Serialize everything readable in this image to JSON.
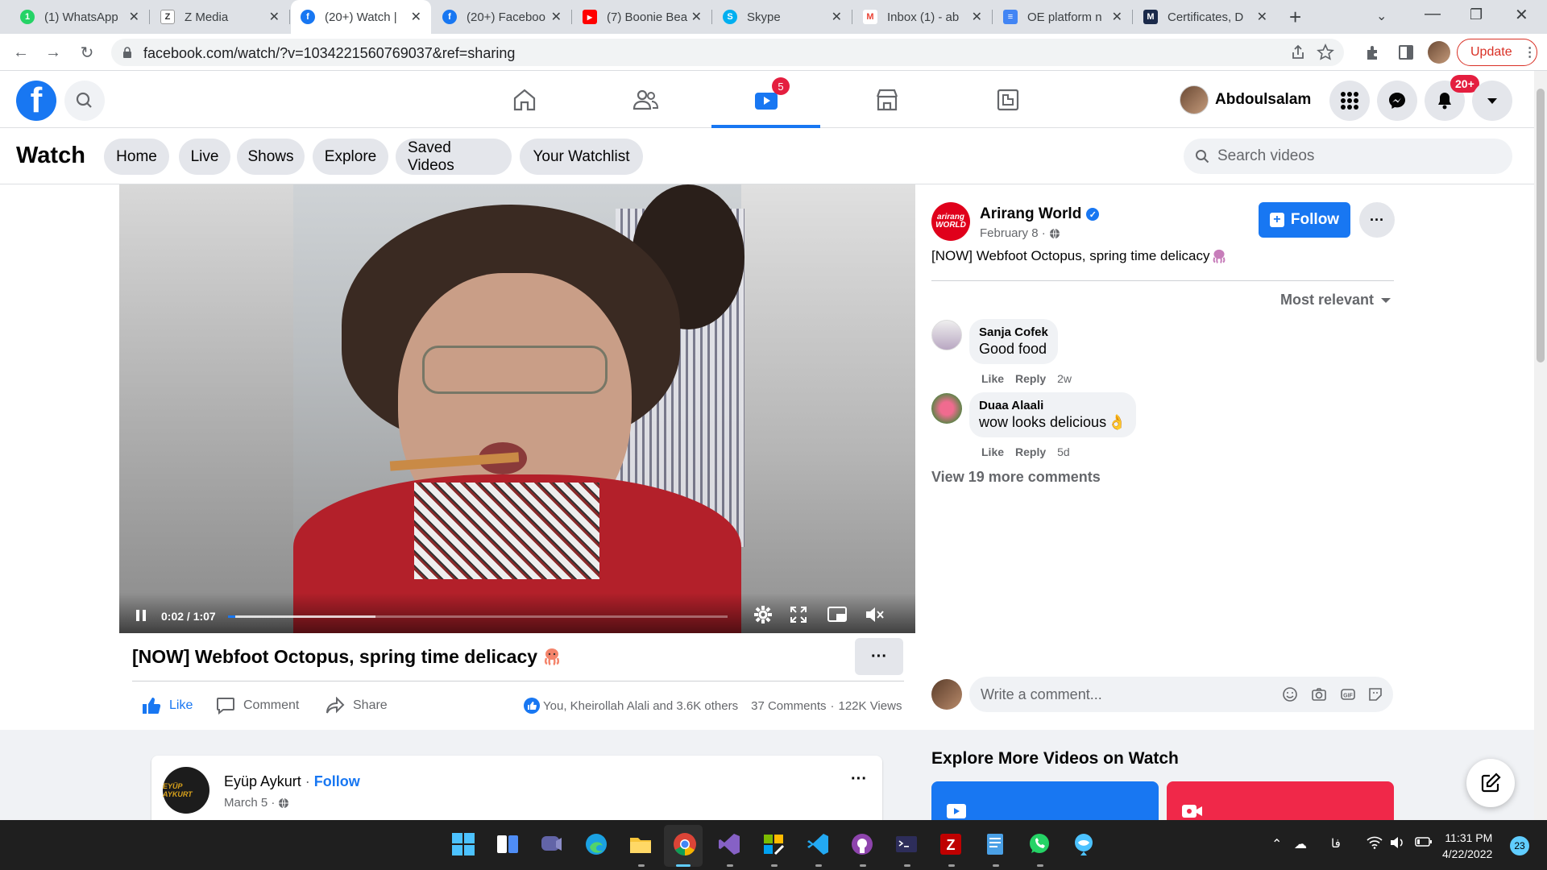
{
  "browser": {
    "tabs": [
      {
        "title": "(1) WhatsApp",
        "favicon": "whatsapp-icon",
        "color": "#25d366",
        "glyph": "1",
        "active": false
      },
      {
        "title": "Z Media",
        "favicon": "z-media-icon",
        "color": "#ffffff",
        "glyph": "Z",
        "active": false
      },
      {
        "title": "(20+) Watch |",
        "favicon": "facebook-icon",
        "color": "#1877f2",
        "glyph": "f",
        "active": true
      },
      {
        "title": "(20+) Faceboo",
        "favicon": "facebook-icon",
        "color": "#1877f2",
        "glyph": "f",
        "active": false
      },
      {
        "title": "(7) Boonie Bea",
        "favicon": "youtube-icon",
        "color": "#ff0000",
        "glyph": "▶",
        "active": false
      },
      {
        "title": "Skype",
        "favicon": "skype-icon",
        "color": "#00aff0",
        "glyph": "S",
        "active": false
      },
      {
        "title": "Inbox (1) - ab",
        "favicon": "gmail-icon",
        "color": "#ffffff",
        "glyph": "M",
        "active": false
      },
      {
        "title": "OE platform n",
        "favicon": "docs-icon",
        "color": "#4285f4",
        "glyph": "≡",
        "active": false
      },
      {
        "title": "Certificates, D",
        "favicon": "m-icon",
        "color": "#1b2a4a",
        "glyph": "M",
        "active": false
      }
    ],
    "url": "facebook.com/watch/?v=1034221560769037&ref=sharing",
    "update_label": "Update"
  },
  "fb": {
    "notification_badge_nav": "5",
    "user_name": "Abdoulsalam",
    "notification_badge": "20+",
    "brand_color": "#1877f2"
  },
  "watch": {
    "title": "Watch",
    "pills": [
      "Home",
      "Live",
      "Shows",
      "Explore",
      "Saved Videos",
      "Your Watchlist"
    ],
    "search_placeholder": "Search videos"
  },
  "video": {
    "time": "0:02 / 1:07",
    "played_fraction": 0.015,
    "title": "[NOW] Webfoot Octopus, spring time delicacy",
    "actions": {
      "like": "Like",
      "comment": "Comment",
      "share": "Share"
    },
    "reactions_text": "You, Kheirollah Alali and 3.6K others",
    "comments_count": "37 Comments",
    "views": "122K Views"
  },
  "page": {
    "logo_text_1": "arirang",
    "logo_text_2": "WORLD",
    "name": "Arirang World",
    "date": "February 8 ·",
    "post_text": "[NOW] Webfoot Octopus, spring time delicacy",
    "follow_label": "Follow"
  },
  "comments": {
    "sort_label": "Most relevant",
    "items": [
      {
        "author": "Sanja Cofek",
        "text": "Good food",
        "like": "Like",
        "reply": "Reply",
        "age": "2w"
      },
      {
        "author": "Duaa Alaali",
        "text": "wow looks delicious",
        "like": "Like",
        "reply": "Reply",
        "age": "5d"
      }
    ],
    "view_more": "View 19 more comments",
    "write_placeholder": "Write a comment..."
  },
  "below": {
    "post_author": "Eyüp Aykurt",
    "post_avatar_text": "EYÜP AYKURT",
    "post_sep": " · ",
    "post_follow": "Follow",
    "post_date": "March 5 ·",
    "explore_title": "Explore More Videos on Watch"
  },
  "taskbar": {
    "time": "11:31 PM",
    "date": "4/22/2022",
    "notifications": "23",
    "lang": "فا"
  }
}
